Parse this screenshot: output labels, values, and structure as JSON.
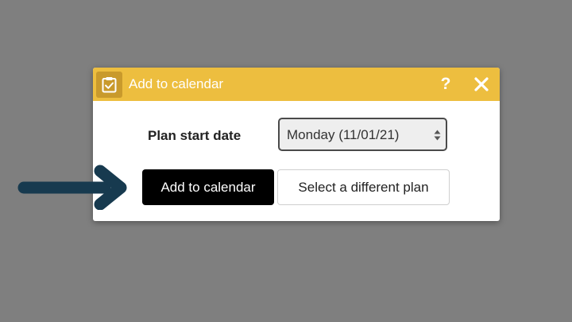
{
  "dialog": {
    "title": "Add to calendar",
    "title_icon": "clipboard-check-icon",
    "help_label": "?",
    "close_icon": "close-icon"
  },
  "form": {
    "plan_start_label": "Plan start date",
    "plan_start_value": "Monday (11/01/21)"
  },
  "actions": {
    "add_label": "Add to calendar",
    "select_other_label": "Select a different plan"
  },
  "annotation": {
    "arrow_icon": "pointer-arrow-icon"
  },
  "colors": {
    "backdrop": "#7f7f7f",
    "titlebar": "#edbe3f",
    "title_icon_bg": "#c99a2c",
    "primary_button": "#000000",
    "arrow": "#173a4f"
  }
}
